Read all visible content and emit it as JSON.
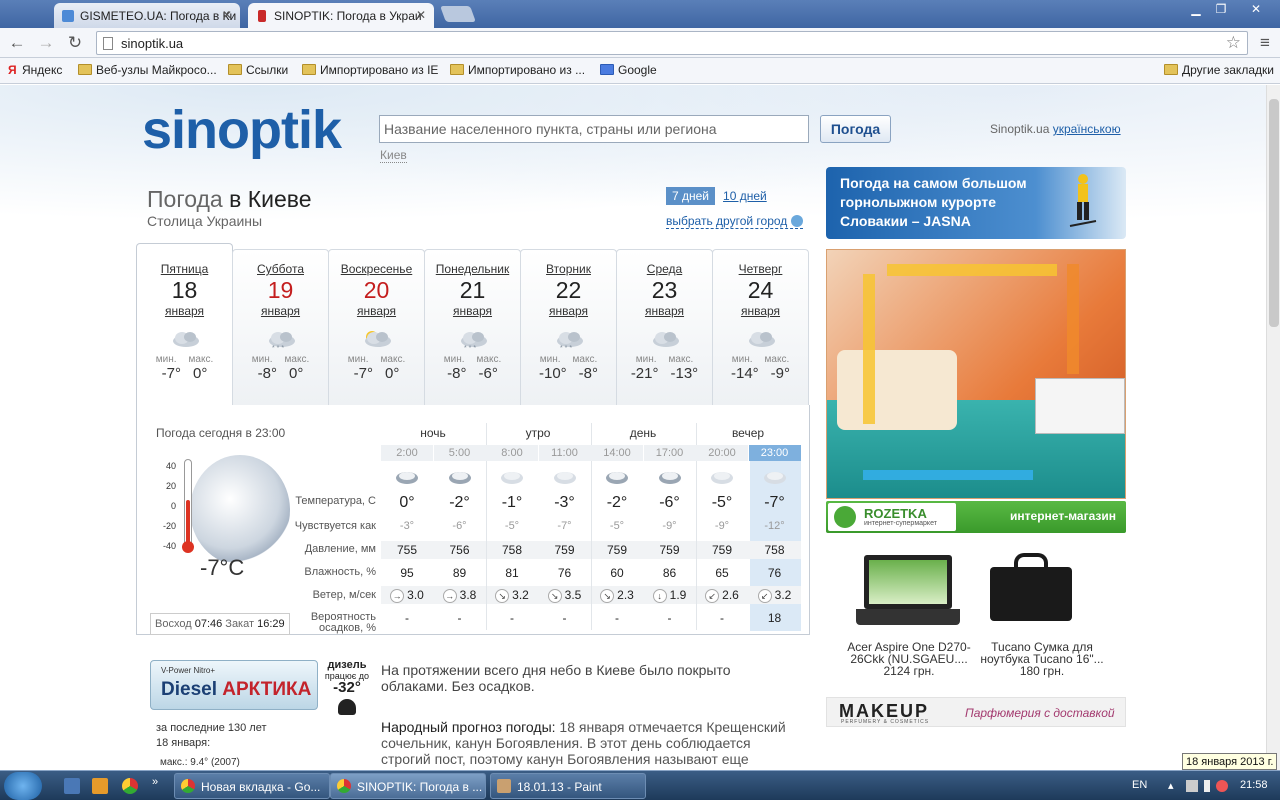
{
  "browser": {
    "tabs": [
      {
        "label": "GISMETEO.UA: Погода в Ки",
        "active": false
      },
      {
        "label": "SINOPTIK: Погода в Украи",
        "active": true
      }
    ],
    "url": "sinoptik.ua",
    "bookmarks": [
      "Яндекс",
      "Веб-узлы Майкросо...",
      "Ссылки",
      "Импортировано из IE",
      "Импортировано из ...",
      "Google"
    ],
    "other_bookmarks": "Другие закладки"
  },
  "site": {
    "logo": "sinoptik",
    "search_placeholder": "Название населенного пункта, страны или региона",
    "search_button": "Погода",
    "search_hint": "Киев",
    "lang_prefix": "Sinoptik.ua",
    "lang_link": "українською"
  },
  "header": {
    "title_prefix": "Погода",
    "title_city": "в Киеве",
    "subtitle": "Столица Украины",
    "range_7": "7 дней",
    "range_10": "10 дней",
    "other_city": "выбрать другой город"
  },
  "days": [
    {
      "name": "Пятница",
      "num": "18",
      "month": "января",
      "min_label": "мин.",
      "max_label": "макс.",
      "min": "-7°",
      "max": "0°",
      "weekend": false,
      "icon": "cloud-icon"
    },
    {
      "name": "Суббота",
      "num": "19",
      "month": "января",
      "min_label": "мин.",
      "max_label": "макс.",
      "min": "-8°",
      "max": "0°",
      "weekend": true,
      "icon": "snow-cloud-icon"
    },
    {
      "name": "Воскресенье",
      "num": "20",
      "month": "января",
      "min_label": "мин.",
      "max_label": "макс.",
      "min": "-7°",
      "max": "0°",
      "weekend": true,
      "icon": "sun-cloud-icon"
    },
    {
      "name": "Понедельник",
      "num": "21",
      "month": "января",
      "min_label": "мин.",
      "max_label": "макс.",
      "min": "-8°",
      "max": "-6°",
      "weekend": false,
      "icon": "snow-cloud-icon"
    },
    {
      "name": "Вторник",
      "num": "22",
      "month": "января",
      "min_label": "мин.",
      "max_label": "макс.",
      "min": "-10°",
      "max": "-8°",
      "weekend": false,
      "icon": "snow-cloud-icon"
    },
    {
      "name": "Среда",
      "num": "23",
      "month": "января",
      "min_label": "мин.",
      "max_label": "макс.",
      "min": "-21°",
      "max": "-13°",
      "weekend": false,
      "icon": "cloud-icon"
    },
    {
      "name": "Четверг",
      "num": "24",
      "month": "января",
      "min_label": "мин.",
      "max_label": "макс.",
      "min": "-14°",
      "max": "-9°",
      "weekend": false,
      "icon": "cloud-icon"
    }
  ],
  "today": {
    "label": "Погода сегодня в 23:00",
    "scale": [
      "40",
      "20",
      "0",
      "-20",
      "-40"
    ],
    "current_temp": "-7°C",
    "sunrise_label": "Восход",
    "sunrise": "07:46",
    "sunset_label": "Закат",
    "sunset": "16:29",
    "periods": [
      "ночь",
      "утро",
      "день",
      "вечер"
    ],
    "hours": [
      "2:00",
      "5:00",
      "8:00",
      "11:00",
      "14:00",
      "17:00",
      "20:00",
      "23:00"
    ],
    "row_labels": [
      "Температура, С",
      "Чувствуется как",
      "Давление, мм",
      "Влажность, %",
      "Ветер, м/сек",
      "Вероятность осадков, %"
    ],
    "temp": [
      "0°",
      "-2°",
      "-1°",
      "-3°",
      "-2°",
      "-6°",
      "-5°",
      "-7°"
    ],
    "feels": [
      "-3°",
      "-6°",
      "-5°",
      "-7°",
      "-5°",
      "-9°",
      "-9°",
      "-12°"
    ],
    "pressure": [
      "755",
      "756",
      "758",
      "759",
      "759",
      "759",
      "759",
      "758"
    ],
    "humidity": [
      "95",
      "89",
      "81",
      "76",
      "60",
      "86",
      "65",
      "76"
    ],
    "wind_dir": [
      "→",
      "→",
      "↘",
      "↘",
      "↘",
      "↓",
      "↙",
      "↙"
    ],
    "wind": [
      "3.0",
      "3.8",
      "3.2",
      "3.5",
      "2.3",
      "1.9",
      "2.6",
      "3.2"
    ],
    "precip": [
      "-",
      "-",
      "-",
      "-",
      "-",
      "-",
      "-",
      "18"
    ]
  },
  "diesel_ad": {
    "vp": "V-Power Nitro+",
    "brand_a": "Diesel",
    "brand_b": "АРКТИКА",
    "r1": "дизель",
    "r2": "працює до",
    "temp": "-32°"
  },
  "history": {
    "line1": "за последние 130 лет",
    "line2": "18 января:",
    "max": "макс.: 9.4° (2007)"
  },
  "description": "На протяжении всего дня небо в Киеве было покрыто облаками. Без осадков.",
  "folk": {
    "label": "Народный прогноз погоды:",
    "text": "18 января отмечается Крещенский сочельник, канун Богоявления. В этот день соблюдается строгий пост, поэтому канун Богоявления называют еще"
  },
  "ads": {
    "ski": "Погода на самом большом горнолыжном курорте Словакии – JASNA",
    "rozetka_logo": "ROZETKA",
    "rozetka_sub": "интернет-супермаркет",
    "rozetka_right": "интернет-магазин",
    "products": [
      {
        "name": "Acer Aspire One D270-26Ckk (NU.SGAEU....",
        "price": "2124 грн."
      },
      {
        "name": "Tucano Сумка для ноутбука Tucano 16\"...",
        "price": "180 грн."
      }
    ],
    "makeup_logo": "MAKEUP",
    "makeup_sub": "PERFUMERY & COSMETICS",
    "makeup_tag": "Парфюмерия с доставкой"
  },
  "taskbar": {
    "buttons": [
      "Новая вкладка - Go...",
      "SINOPTIK: Погода в ...",
      "18.01.13 - Paint"
    ],
    "lang": "EN",
    "time": "21:58",
    "tooltip": "18 января 2013 г."
  }
}
